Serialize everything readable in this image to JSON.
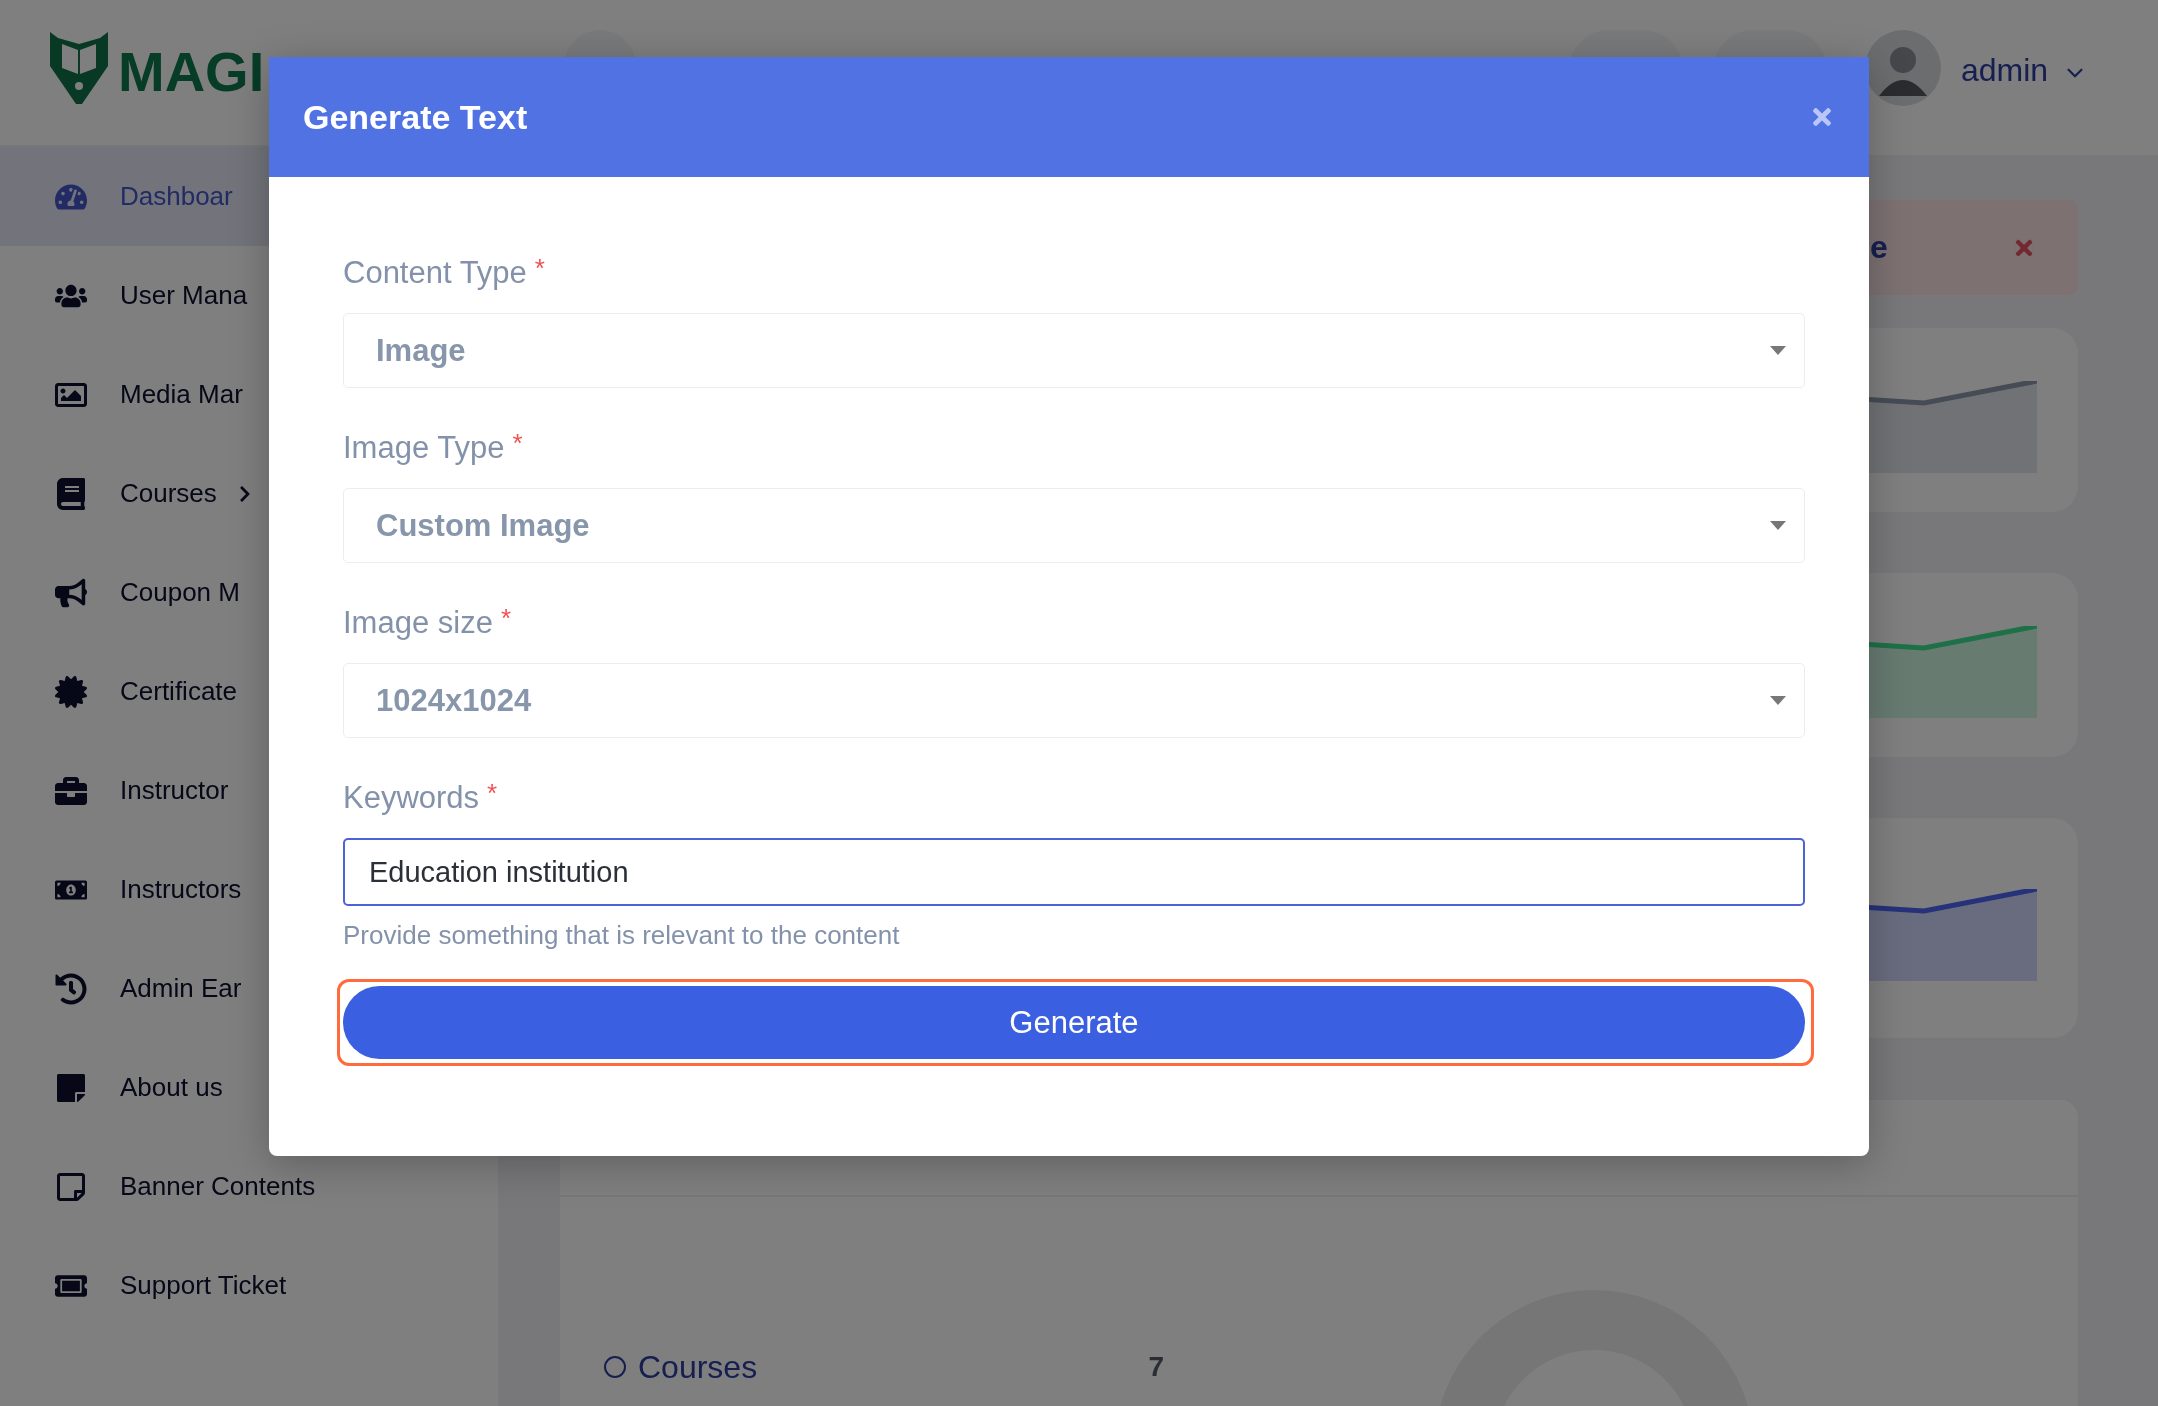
{
  "logo": {
    "text": "MAGI"
  },
  "sidebar": {
    "items": [
      {
        "label": "Dashboar",
        "selected": true,
        "expandable": false
      },
      {
        "label": "User Mana",
        "selected": false,
        "expandable": false
      },
      {
        "label": "Media Mar",
        "selected": false,
        "expandable": false
      },
      {
        "label": "Courses",
        "selected": false,
        "expandable": true
      },
      {
        "label": "Coupon M",
        "selected": false,
        "expandable": false
      },
      {
        "label": "Certificate",
        "selected": false,
        "expandable": false
      },
      {
        "label": "Instructor",
        "selected": false,
        "expandable": false
      },
      {
        "label": "Instructors",
        "selected": false,
        "expandable": false
      },
      {
        "label": "Admin Ear",
        "selected": false,
        "expandable": false
      },
      {
        "label": "About us",
        "selected": false,
        "expandable": false
      },
      {
        "label": "Banner Contents",
        "selected": false,
        "expandable": false
      },
      {
        "label": "Support Ticket",
        "selected": false,
        "expandable": false
      }
    ]
  },
  "header": {
    "user": "admin"
  },
  "alert": {
    "text": "e"
  },
  "stat_cards": [
    {
      "color": "#464c56"
    },
    {
      "color": "#1e7048"
    },
    {
      "color": "#26327a"
    }
  ],
  "status": {
    "legend": [
      {
        "label": "Courses",
        "value": "7"
      }
    ]
  },
  "modal": {
    "title": "Generate Text",
    "fields": [
      {
        "kind": "select",
        "label": "Content Type",
        "required_mark": "*",
        "value": "Image"
      },
      {
        "kind": "select",
        "label": "Image Type",
        "required_mark": "*",
        "value": "Custom Image"
      },
      {
        "kind": "select",
        "label": "Image size",
        "required_mark": "*",
        "value": "1024x1024"
      },
      {
        "kind": "text",
        "label": "Keywords",
        "required_mark": "*",
        "value": "Education institution"
      }
    ],
    "help": "Provide something that is relevant to the content",
    "button": {
      "label": "Generate",
      "focused": true
    }
  }
}
